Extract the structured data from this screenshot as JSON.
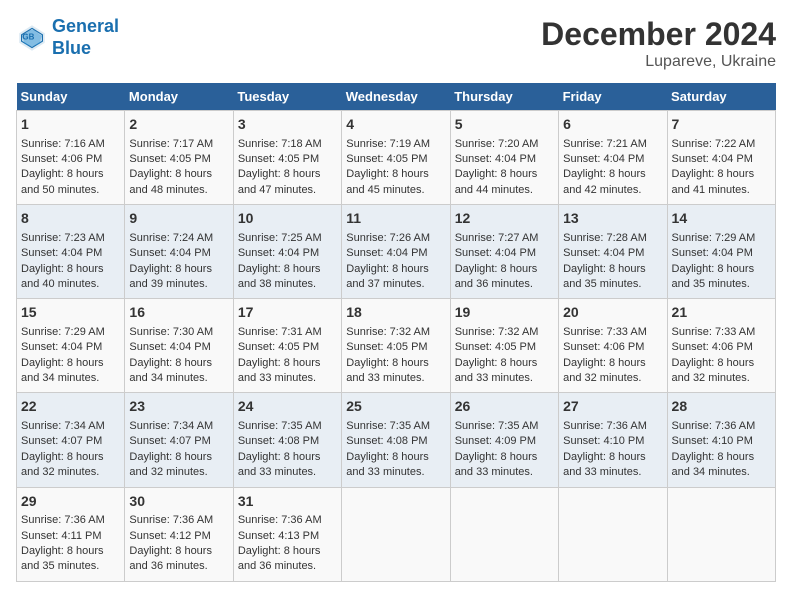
{
  "logo": {
    "line1": "General",
    "line2": "Blue"
  },
  "title": "December 2024",
  "subtitle": "Lupareve, Ukraine",
  "days_header": [
    "Sunday",
    "Monday",
    "Tuesday",
    "Wednesday",
    "Thursday",
    "Friday",
    "Saturday"
  ],
  "weeks": [
    [
      {
        "day": "1",
        "sunrise": "Sunrise: 7:16 AM",
        "sunset": "Sunset: 4:06 PM",
        "daylight": "Daylight: 8 hours and 50 minutes."
      },
      {
        "day": "2",
        "sunrise": "Sunrise: 7:17 AM",
        "sunset": "Sunset: 4:05 PM",
        "daylight": "Daylight: 8 hours and 48 minutes."
      },
      {
        "day": "3",
        "sunrise": "Sunrise: 7:18 AM",
        "sunset": "Sunset: 4:05 PM",
        "daylight": "Daylight: 8 hours and 47 minutes."
      },
      {
        "day": "4",
        "sunrise": "Sunrise: 7:19 AM",
        "sunset": "Sunset: 4:05 PM",
        "daylight": "Daylight: 8 hours and 45 minutes."
      },
      {
        "day": "5",
        "sunrise": "Sunrise: 7:20 AM",
        "sunset": "Sunset: 4:04 PM",
        "daylight": "Daylight: 8 hours and 44 minutes."
      },
      {
        "day": "6",
        "sunrise": "Sunrise: 7:21 AM",
        "sunset": "Sunset: 4:04 PM",
        "daylight": "Daylight: 8 hours and 42 minutes."
      },
      {
        "day": "7",
        "sunrise": "Sunrise: 7:22 AM",
        "sunset": "Sunset: 4:04 PM",
        "daylight": "Daylight: 8 hours and 41 minutes."
      }
    ],
    [
      {
        "day": "8",
        "sunrise": "Sunrise: 7:23 AM",
        "sunset": "Sunset: 4:04 PM",
        "daylight": "Daylight: 8 hours and 40 minutes."
      },
      {
        "day": "9",
        "sunrise": "Sunrise: 7:24 AM",
        "sunset": "Sunset: 4:04 PM",
        "daylight": "Daylight: 8 hours and 39 minutes."
      },
      {
        "day": "10",
        "sunrise": "Sunrise: 7:25 AM",
        "sunset": "Sunset: 4:04 PM",
        "daylight": "Daylight: 8 hours and 38 minutes."
      },
      {
        "day": "11",
        "sunrise": "Sunrise: 7:26 AM",
        "sunset": "Sunset: 4:04 PM",
        "daylight": "Daylight: 8 hours and 37 minutes."
      },
      {
        "day": "12",
        "sunrise": "Sunrise: 7:27 AM",
        "sunset": "Sunset: 4:04 PM",
        "daylight": "Daylight: 8 hours and 36 minutes."
      },
      {
        "day": "13",
        "sunrise": "Sunrise: 7:28 AM",
        "sunset": "Sunset: 4:04 PM",
        "daylight": "Daylight: 8 hours and 35 minutes."
      },
      {
        "day": "14",
        "sunrise": "Sunrise: 7:29 AM",
        "sunset": "Sunset: 4:04 PM",
        "daylight": "Daylight: 8 hours and 35 minutes."
      }
    ],
    [
      {
        "day": "15",
        "sunrise": "Sunrise: 7:29 AM",
        "sunset": "Sunset: 4:04 PM",
        "daylight": "Daylight: 8 hours and 34 minutes."
      },
      {
        "day": "16",
        "sunrise": "Sunrise: 7:30 AM",
        "sunset": "Sunset: 4:04 PM",
        "daylight": "Daylight: 8 hours and 34 minutes."
      },
      {
        "day": "17",
        "sunrise": "Sunrise: 7:31 AM",
        "sunset": "Sunset: 4:05 PM",
        "daylight": "Daylight: 8 hours and 33 minutes."
      },
      {
        "day": "18",
        "sunrise": "Sunrise: 7:32 AM",
        "sunset": "Sunset: 4:05 PM",
        "daylight": "Daylight: 8 hours and 33 minutes."
      },
      {
        "day": "19",
        "sunrise": "Sunrise: 7:32 AM",
        "sunset": "Sunset: 4:05 PM",
        "daylight": "Daylight: 8 hours and 33 minutes."
      },
      {
        "day": "20",
        "sunrise": "Sunrise: 7:33 AM",
        "sunset": "Sunset: 4:06 PM",
        "daylight": "Daylight: 8 hours and 32 minutes."
      },
      {
        "day": "21",
        "sunrise": "Sunrise: 7:33 AM",
        "sunset": "Sunset: 4:06 PM",
        "daylight": "Daylight: 8 hours and 32 minutes."
      }
    ],
    [
      {
        "day": "22",
        "sunrise": "Sunrise: 7:34 AM",
        "sunset": "Sunset: 4:07 PM",
        "daylight": "Daylight: 8 hours and 32 minutes."
      },
      {
        "day": "23",
        "sunrise": "Sunrise: 7:34 AM",
        "sunset": "Sunset: 4:07 PM",
        "daylight": "Daylight: 8 hours and 32 minutes."
      },
      {
        "day": "24",
        "sunrise": "Sunrise: 7:35 AM",
        "sunset": "Sunset: 4:08 PM",
        "daylight": "Daylight: 8 hours and 33 minutes."
      },
      {
        "day": "25",
        "sunrise": "Sunrise: 7:35 AM",
        "sunset": "Sunset: 4:08 PM",
        "daylight": "Daylight: 8 hours and 33 minutes."
      },
      {
        "day": "26",
        "sunrise": "Sunrise: 7:35 AM",
        "sunset": "Sunset: 4:09 PM",
        "daylight": "Daylight: 8 hours and 33 minutes."
      },
      {
        "day": "27",
        "sunrise": "Sunrise: 7:36 AM",
        "sunset": "Sunset: 4:10 PM",
        "daylight": "Daylight: 8 hours and 33 minutes."
      },
      {
        "day": "28",
        "sunrise": "Sunrise: 7:36 AM",
        "sunset": "Sunset: 4:10 PM",
        "daylight": "Daylight: 8 hours and 34 minutes."
      }
    ],
    [
      {
        "day": "29",
        "sunrise": "Sunrise: 7:36 AM",
        "sunset": "Sunset: 4:11 PM",
        "daylight": "Daylight: 8 hours and 35 minutes."
      },
      {
        "day": "30",
        "sunrise": "Sunrise: 7:36 AM",
        "sunset": "Sunset: 4:12 PM",
        "daylight": "Daylight: 8 hours and 36 minutes."
      },
      {
        "day": "31",
        "sunrise": "Sunrise: 7:36 AM",
        "sunset": "Sunset: 4:13 PM",
        "daylight": "Daylight: 8 hours and 36 minutes."
      },
      null,
      null,
      null,
      null
    ]
  ]
}
